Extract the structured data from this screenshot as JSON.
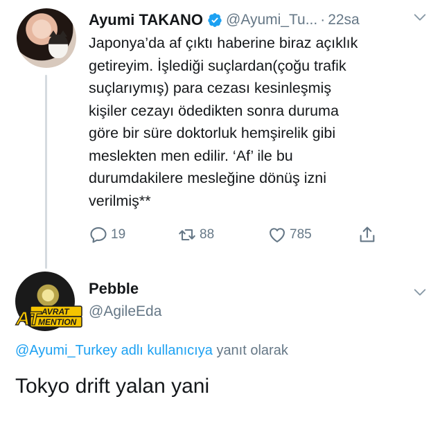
{
  "tweet1": {
    "author_name": "Ayumi TAKANO",
    "handle": "@Ayumi_Tu...",
    "separator": "·",
    "time": "22sa",
    "text": "Japonya’da af çıktı haberine biraz açıklık\ngetireyim. İşlediği suçlardan(çoğu trafik\nsuçlarıymış) para cezası kesinleşmiş\nkişiler cezayı ödedikten sonra duruma\ngöre bir süre doktorluk hemşirelik gibi\nmeslekten men edilir. ‘Af’ ile bu\ndurumdakilere mesleğine dönüş izni\nverilmiş**",
    "reply_count": "19",
    "retweet_count": "88",
    "like_count": "785",
    "icons": [
      "verified-badge-icon",
      "chevron-down-icon",
      "reply-icon",
      "retweet-icon",
      "like-icon",
      "share-icon"
    ]
  },
  "tweet2": {
    "author_name": "Pebble",
    "handle": "@AgileEda",
    "avatar_badge_text": [
      "AT",
      "AVRAT",
      "MENTION"
    ],
    "reply_prefix": "@Ayumi_Turkey adlı kullanıcıya",
    "reply_suffix": "yanıt olarak",
    "text": "Tokyo drift yalan yani"
  },
  "colors": {
    "text": "#14171a",
    "secondary": "#657786",
    "link": "#1da1f2",
    "thread_line": "#d5dbe0"
  }
}
